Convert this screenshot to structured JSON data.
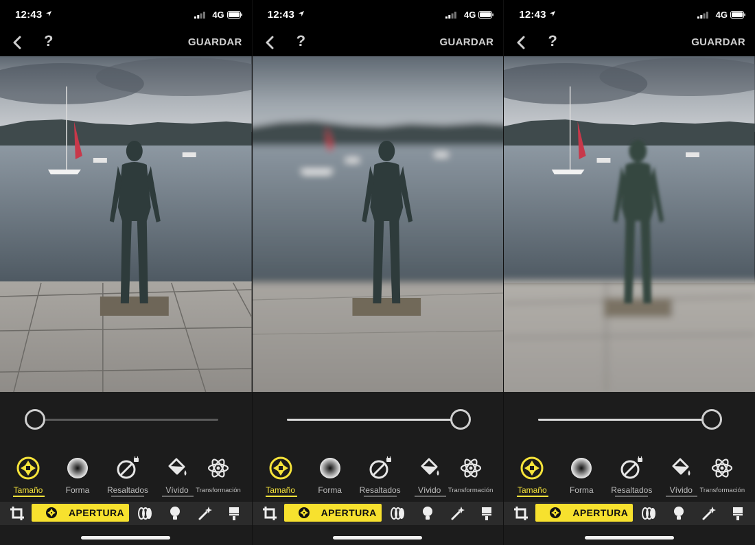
{
  "status_bar": {
    "time": "12:43",
    "network": "4G"
  },
  "nav": {
    "save_label": "GUARDAR",
    "help_label": "?"
  },
  "tools": [
    {
      "label": "Tamaño",
      "icon": "aperture-icon",
      "active": true
    },
    {
      "label": "Forma",
      "icon": "radial-gradient-circle-icon",
      "active": false
    },
    {
      "label": "Resaltados",
      "icon": "highlights-icon",
      "active": false,
      "locked": true
    },
    {
      "label": "Vívido",
      "icon": "paint-bucket-icon",
      "active": false
    },
    {
      "label": "Transformación",
      "icon": "atom-icon",
      "active": false
    }
  ],
  "bottom_bar": {
    "mode_label": "APERTURA"
  },
  "panels": [
    {
      "slider_value": 0.0,
      "blur": "none"
    },
    {
      "slider_value": 1.0,
      "blur": "background"
    },
    {
      "slider_value": 1.0,
      "blur": "full"
    }
  ],
  "colors": {
    "accent": "#f7e12e",
    "bar_bg": "#1c1c1c",
    "bottom_bar_bg": "#2b2b2b"
  }
}
